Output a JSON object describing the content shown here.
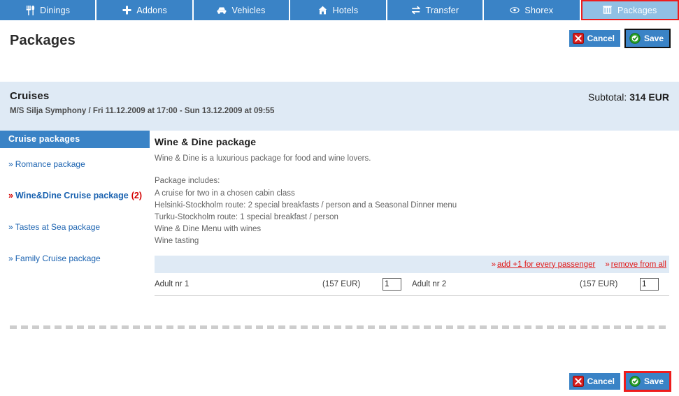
{
  "tabs": [
    {
      "label": "Dinings",
      "icon": "fork-knife-icon",
      "active": false
    },
    {
      "label": "Addons",
      "icon": "plus-icon",
      "active": false
    },
    {
      "label": "Vehicles",
      "icon": "car-icon",
      "active": false
    },
    {
      "label": "Hotels",
      "icon": "hotel-icon",
      "active": false
    },
    {
      "label": "Transfer",
      "icon": "transfer-arrows-icon",
      "active": false
    },
    {
      "label": "Shorex",
      "icon": "eye-icon",
      "active": false
    },
    {
      "label": "Packages",
      "icon": "package-icon",
      "active": true
    }
  ],
  "page": {
    "title": "Packages"
  },
  "toolbar": {
    "cancel_label": "Cancel",
    "save_label": "Save"
  },
  "cruise": {
    "title": "Cruises",
    "subtitle": "M/S Silja Symphony / Fri 11.12.2009 at 17:00 - Sun 13.12.2009 at 09:55",
    "subtotal_label": "Subtotal:",
    "subtotal_value": "314 EUR"
  },
  "sidebar": {
    "header": "Cruise packages",
    "items": [
      {
        "label": "Romance package",
        "count": "",
        "active": false
      },
      {
        "label": "Wine&Dine Cruise package",
        "count": "(2)",
        "active": true
      },
      {
        "label": "Tastes at Sea package",
        "count": "",
        "active": false
      },
      {
        "label": "Family Cruise package",
        "count": "",
        "active": false
      }
    ]
  },
  "package": {
    "title": "Wine & Dine package",
    "description": "Wine & Dine is a luxurious package for food and wine lovers.",
    "includes_label": "Package includes:",
    "includes": [
      "A cruise for two in a chosen cabin class",
      "Helsinki-Stockholm route: 2 special breakfasts / person and a Seasonal Dinner menu",
      "Turku-Stockholm route: 1 special breakfast / person",
      "Wine & Dine Menu with wines",
      "Wine tasting"
    ]
  },
  "actions": {
    "add_all_label": "add +1 for every passenger",
    "remove_all_label": "remove from all"
  },
  "passengers": [
    {
      "name": "Adult nr 1",
      "price": "(157 EUR)",
      "qty": "1"
    },
    {
      "name": "Adult nr 2",
      "price": "(157 EUR)",
      "qty": "1"
    }
  ],
  "colors": {
    "tab_blue": "#3a83c6",
    "tab_active_blue": "#91c0e4",
    "focus_red": "#ee1c1c",
    "band_blue": "#dfeaf5",
    "link_blue": "#1a62b0",
    "link_red": "#e01b1b"
  }
}
